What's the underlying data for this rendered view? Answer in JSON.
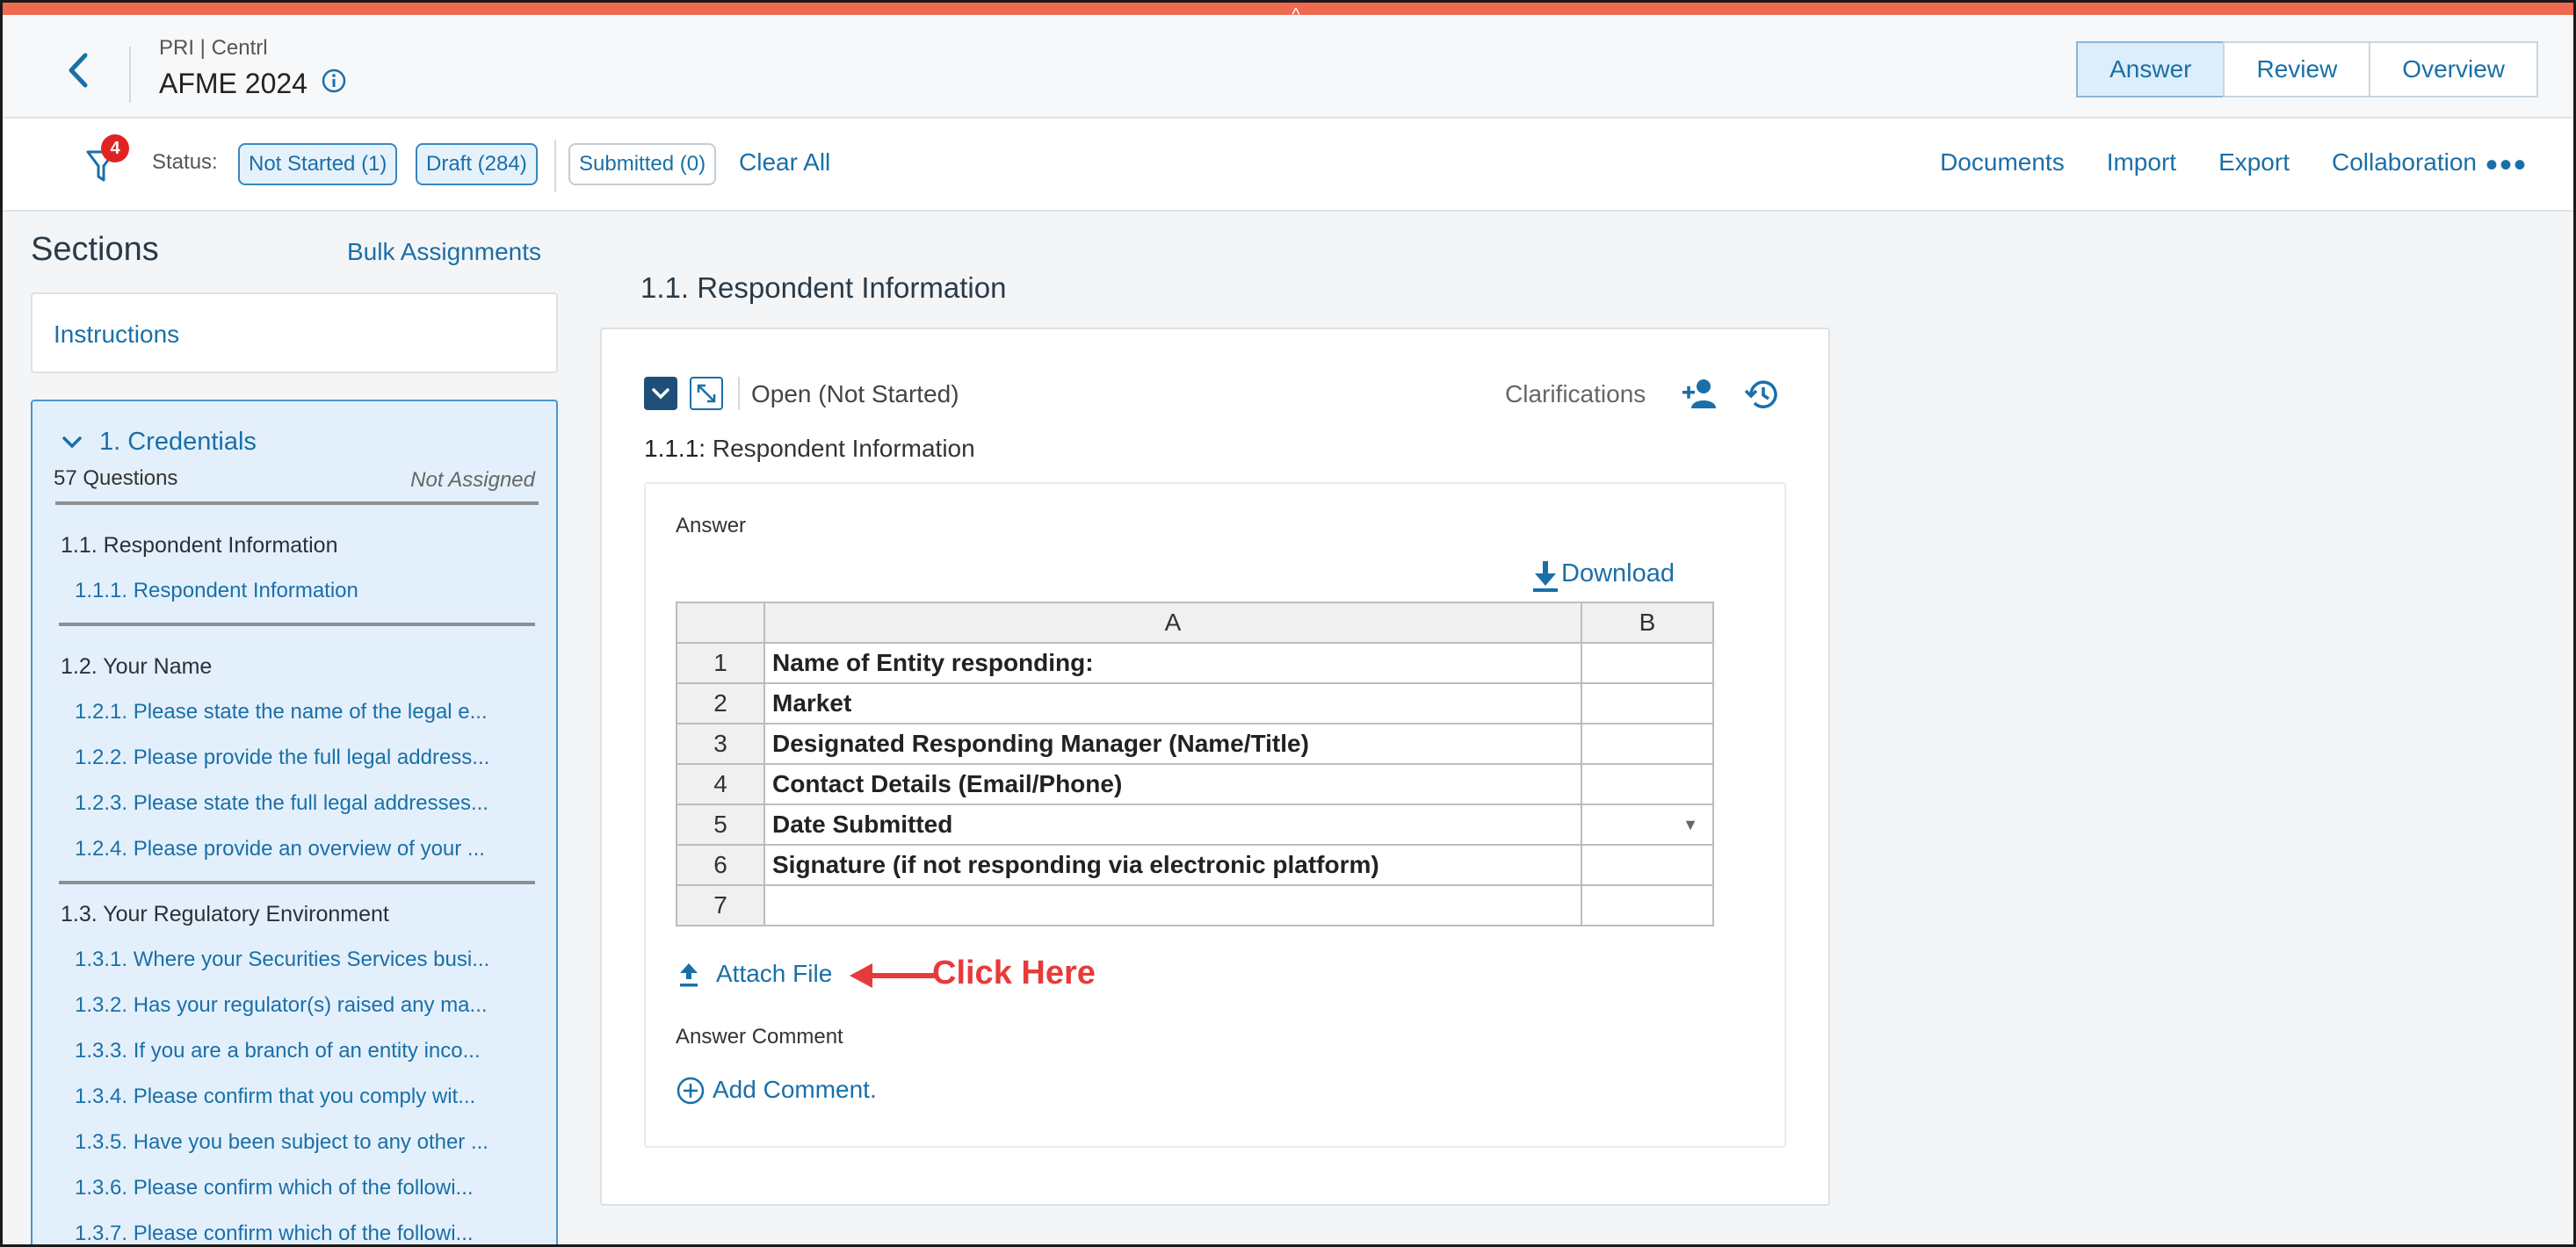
{
  "header": {
    "breadcrumb": "PRI | Centrl",
    "title": "AFME 2024",
    "tabs": [
      "Answer",
      "Review",
      "Overview"
    ],
    "active_tab": "Answer",
    "collapse_glyph": "^"
  },
  "filterbar": {
    "badge": "4",
    "status_label": "Status:",
    "chips": [
      "Not Started (1)",
      "Draft (284)",
      "Submitted (0)"
    ],
    "clear_all": "Clear All",
    "links": [
      "Documents",
      "Import",
      "Export",
      "Collaboration"
    ],
    "more": "•••"
  },
  "sidebar": {
    "title": "Sections",
    "bulk": "Bulk Assignments",
    "instructions": "Instructions",
    "section": {
      "title": "1. Credentials",
      "count": "57 Questions",
      "assignment": "Not Assigned"
    },
    "groups": [
      {
        "title": "1.1. Respondent Information",
        "items": [
          "1.1.1. Respondent Information"
        ]
      },
      {
        "title": "1.2. Your Name",
        "items": [
          "1.2.1. Please state the name of the legal e...",
          "1.2.2. Please provide the full legal address...",
          "1.2.3. Please state the full legal addresses...",
          "1.2.4. Please provide an overview of your ..."
        ]
      },
      {
        "title": "1.3. Your Regulatory Environment",
        "items": [
          "1.3.1. Where your Securities Services busi...",
          "1.3.2. Has your regulator(s) raised any ma...",
          "1.3.3. If you are a branch of an entity inco...",
          "1.3.4. Please confirm that you comply wit...",
          "1.3.5. Have you been subject to any other ...",
          "1.3.6. Please confirm which of the followi...",
          "1.3.7. Please confirm which of the followi..."
        ]
      }
    ]
  },
  "main": {
    "title": "1.1. Respondent Information",
    "status": "Open (Not Started)",
    "clarifications": "Clarifications",
    "sub_num": "1.1.1:",
    "sub_text": "Respondent Information",
    "answer_label": "Answer",
    "download": "Download",
    "columns": [
      "A",
      "B"
    ],
    "rows": [
      {
        "n": "1",
        "a": "Name of Entity responding:"
      },
      {
        "n": "2",
        "a": "Market"
      },
      {
        "n": "3",
        "a": "Designated Responding Manager (Name/Title)"
      },
      {
        "n": "4",
        "a": "Contact Details (Email/Phone)"
      },
      {
        "n": "5",
        "a": "Date Submitted"
      },
      {
        "n": "6",
        "a": "Signature (if not responding via electronic platform)"
      },
      {
        "n": "7",
        "a": ""
      }
    ],
    "dropdown_glyph": "▼",
    "attach": "Attach File",
    "annotation": "Click Here",
    "comment_label": "Answer Comment",
    "add_comment": "Add Comment."
  },
  "colors": {
    "accent": "#1a6fa8",
    "topbar": "#f06a50",
    "annotation": "#e83a3a",
    "badge": "#e02424"
  }
}
